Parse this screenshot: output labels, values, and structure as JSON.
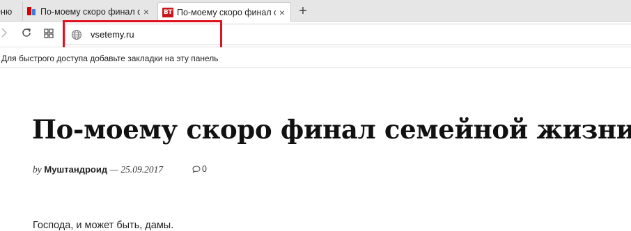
{
  "tabs": {
    "cut_label": "еню",
    "items": [
      {
        "label": "По-моему скоро финал с",
        "favicon": "yandex-favicon",
        "active": false
      },
      {
        "label": "По-моему скоро финал с",
        "favicon": "vt-favicon",
        "favicon_text": "ВТ",
        "active": true
      }
    ],
    "close_glyph": "×",
    "new_tab_glyph": "+"
  },
  "toolbar": {
    "url": "vsetemy.ru",
    "forward_icon": "chevron-right-icon",
    "reload_icon": "reload-icon",
    "tabs_grid_icon": "grid-icon",
    "site_icon": "globe-icon",
    "highlight_color": "#e0121f"
  },
  "bookmarks": {
    "hint": "Для быстрого доступа добавьте закладки на эту панель"
  },
  "article": {
    "title": "По-моему скоро финал семейной жизни",
    "by": "by",
    "author": "Муштандроид",
    "date_sep": "—",
    "date": "25.09.2017",
    "comment_count": "0",
    "lead": "Господа, и может быть, дамы."
  }
}
